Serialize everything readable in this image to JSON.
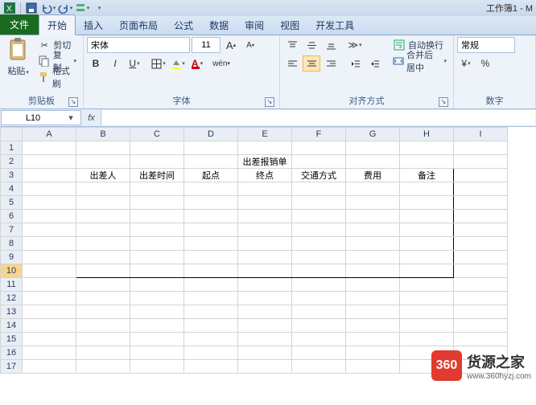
{
  "title": "工作簿1 - M",
  "tabs": {
    "file": "文件",
    "home": "开始",
    "insert": "插入",
    "layout": "页面布局",
    "formulas": "公式",
    "data": "数据",
    "review": "审阅",
    "view": "视图",
    "dev": "开发工具"
  },
  "clipboard": {
    "paste": "粘贴",
    "cut": "剪切",
    "copy": "复制",
    "format": "格式刷",
    "title": "剪贴板"
  },
  "font": {
    "name": "宋体",
    "size": "11",
    "title": "字体"
  },
  "align": {
    "wrap": "自动换行",
    "merge": "合并后居中",
    "title": "对齐方式"
  },
  "number": {
    "format": "常规",
    "title": "数字"
  },
  "namebox_value": "L10",
  "columns": [
    "A",
    "B",
    "C",
    "D",
    "E",
    "F",
    "G",
    "H",
    "I"
  ],
  "rows_count": 17,
  "selected_row": 10,
  "sheet": {
    "title_cell": "出差报销单",
    "headers": [
      "出差人",
      "出差时间",
      "起点",
      "终点",
      "交通方式",
      "费用",
      "备注"
    ]
  },
  "watermark": {
    "badge": "360",
    "name": "货源之家",
    "url": "www.360hyzj.com"
  },
  "chart_data": {
    "type": "table",
    "title": "出差报销单",
    "columns": [
      "出差人",
      "出差时间",
      "起点",
      "终点",
      "交通方式",
      "费用",
      "备注"
    ],
    "rows": [
      [
        "",
        "",
        "",
        "",
        "",
        "",
        ""
      ],
      [
        "",
        "",
        "",
        "",
        "",
        "",
        ""
      ],
      [
        "",
        "",
        "",
        "",
        "",
        "",
        ""
      ],
      [
        "",
        "",
        "",
        "",
        "",
        "",
        ""
      ],
      [
        "",
        "",
        "",
        "",
        "",
        "",
        ""
      ],
      [
        "",
        "",
        "",
        "",
        "",
        "",
        ""
      ],
      [
        "",
        "",
        "",
        "",
        "",
        "",
        ""
      ]
    ]
  }
}
